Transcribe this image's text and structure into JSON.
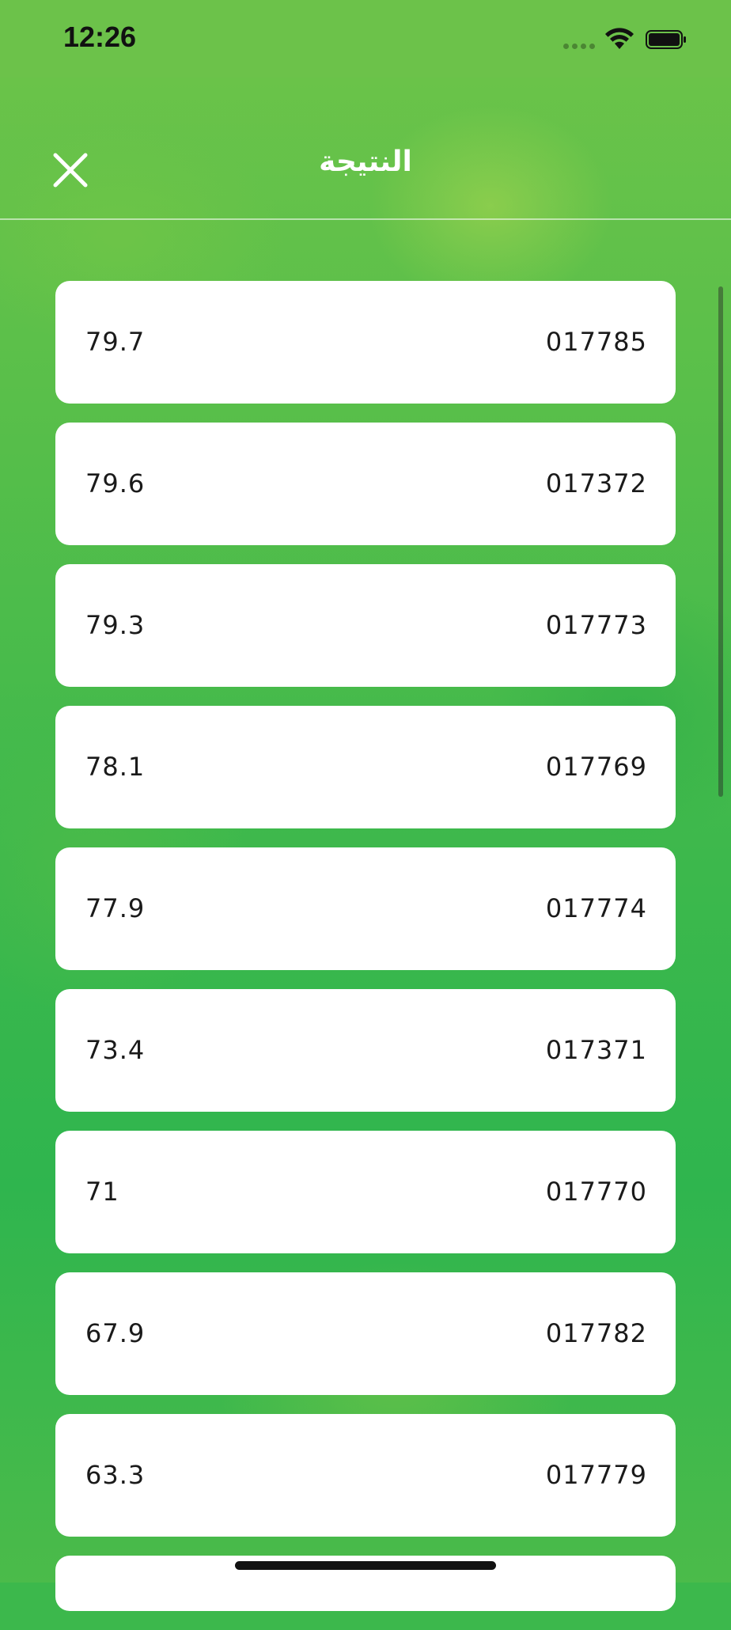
{
  "status_bar": {
    "time": "12:26"
  },
  "header": {
    "title": "النتيجة",
    "close_icon": "close-icon"
  },
  "results": [
    {
      "score": "79.7",
      "code": "017785"
    },
    {
      "score": "79.6",
      "code": "017372"
    },
    {
      "score": "79.3",
      "code": "017773"
    },
    {
      "score": "78.1",
      "code": "017769"
    },
    {
      "score": "77.9",
      "code": "017774"
    },
    {
      "score": "73.4",
      "code": "017371"
    },
    {
      "score": "71",
      "code": "017770"
    },
    {
      "score": "67.9",
      "code": "017782"
    },
    {
      "score": "63.3",
      "code": "017779"
    }
  ],
  "colors": {
    "status_bar": "#6cc24a",
    "background": "#3cb84c",
    "card": "#ffffff",
    "text": "#1a1a1a"
  }
}
